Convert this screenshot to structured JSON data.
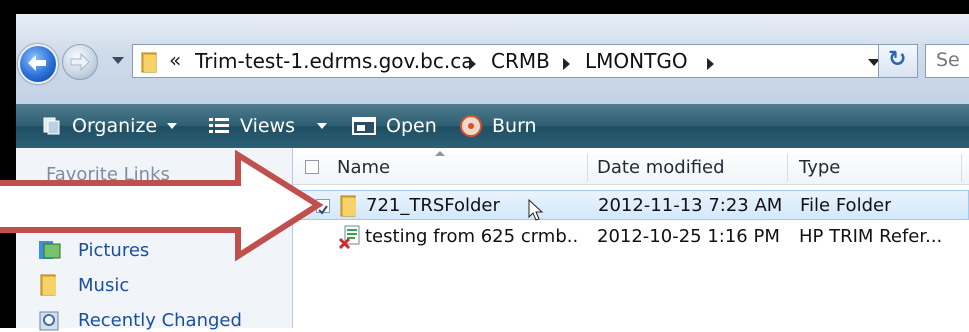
{
  "nav": {
    "back_icon": "back-arrow-icon",
    "forward_icon": "forward-arrow-icon"
  },
  "address": {
    "chevron": "«",
    "segments": [
      "Trim-test-1.edrms.gov.bc.ca",
      "CRMB",
      "LMONTGO"
    ]
  },
  "search": {
    "placeholder": "Se"
  },
  "toolbar": {
    "organize": "Organize",
    "views": "Views",
    "open": "Open",
    "burn": "Burn"
  },
  "navpane": {
    "title": "Favorite Links",
    "items": [
      {
        "label": "Pictures",
        "icon": "pictures-icon"
      },
      {
        "label": "Music",
        "icon": "music-folder-icon"
      },
      {
        "label": "Recently Changed",
        "icon": "recently-changed-icon"
      }
    ]
  },
  "columns": {
    "name": "Name",
    "date": "Date modified",
    "type": "Type"
  },
  "files": [
    {
      "name": "721_TRSFolder",
      "date": "2012-11-13 7:23 AM",
      "type": "File Folder",
      "selected": true,
      "icon": "folder-icon"
    },
    {
      "name": "testing from 625 crmb...",
      "date": "2012-10-25 1:16 PM",
      "type": "HP TRIM Refer...",
      "selected": false,
      "icon": "trim-reference-file-icon"
    }
  ],
  "colors": {
    "annotation_arrow": "#c0504d",
    "toolbar": "#2e5e72",
    "link": "#1a4fa0"
  }
}
